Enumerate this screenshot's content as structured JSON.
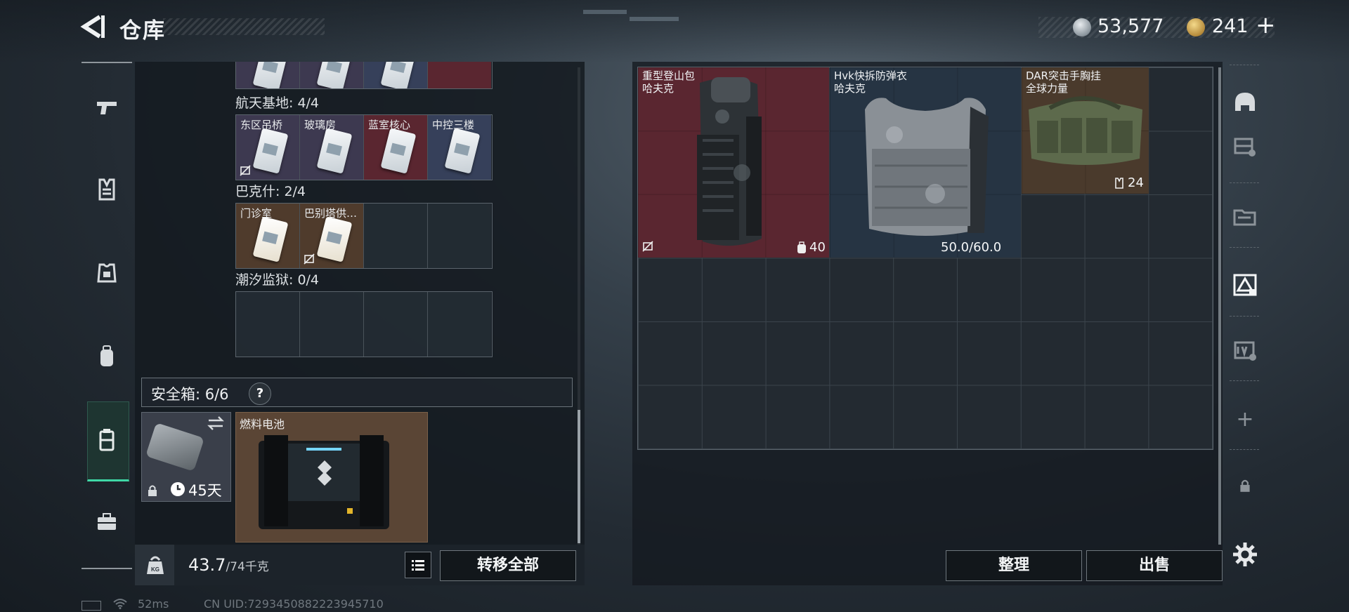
{
  "header": {
    "title": "仓库",
    "currency_1": "53,577",
    "currency_2": "241",
    "currency_add": "+"
  },
  "keycard_sections": [
    {
      "label": "航天基地: 4/4",
      "cards": [
        {
          "name": "东区吊桥",
          "tint": "purple",
          "no_trade": true
        },
        {
          "name": "玻璃房",
          "tint": "purple",
          "no_trade": false
        },
        {
          "name": "蓝室核心",
          "tint": "red",
          "no_trade": false
        },
        {
          "name": "中控三楼",
          "tint": "navy",
          "no_trade": false
        }
      ]
    },
    {
      "label": "巴克什: 2/4",
      "cards": [
        {
          "name": "门诊室",
          "tint": "brown",
          "no_trade": false
        },
        {
          "name": "巴别塔供…",
          "tint": "brown",
          "no_trade": true
        }
      ]
    },
    {
      "label": "潮汐监狱: 0/4",
      "cards": []
    }
  ],
  "safe_box": {
    "label": "安全箱: 6/6",
    "help": "?",
    "days_left": "45天",
    "item_name": "燃料电池"
  },
  "weight": {
    "current": "43.7",
    "max": "/74千克"
  },
  "buttons": {
    "transfer_all": "转移全部",
    "sort": "整理",
    "sell": "出售"
  },
  "equipped": {
    "bag": {
      "name_line1": "重型登山包",
      "name_line2": "哈夫克",
      "capacity": "40"
    },
    "vest": {
      "name_line1": "Hvk快拆防弹衣",
      "name_line2": "哈夫克",
      "durability": "50.0/60.0"
    },
    "rig": {
      "name_line1": "DAR突击手胸挂",
      "name_line2": "全球力量",
      "capacity": "24"
    }
  },
  "right_sidebar": {
    "add": "+"
  },
  "footer": {
    "ping": "52ms",
    "uid": "CN UID:7293450882223945710"
  },
  "colors": {
    "accent_green": "#3fd8a6",
    "tier_red": "#5a2630",
    "tier_purple": "#3d3950",
    "tier_brown": "#4f3b2c"
  }
}
